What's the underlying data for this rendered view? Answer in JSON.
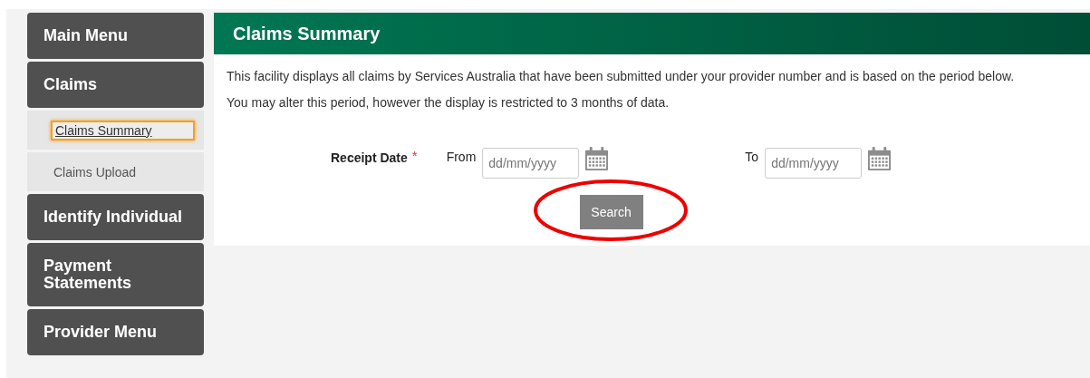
{
  "sidebar": {
    "items": [
      {
        "kind": "section",
        "label": "Main Menu"
      },
      {
        "kind": "section",
        "label": "Claims"
      },
      {
        "kind": "sub",
        "label": "Claims Summary",
        "selected": true
      },
      {
        "kind": "sub",
        "label": "Claims Upload",
        "selected": false
      },
      {
        "kind": "section",
        "label": "Identify Individual"
      },
      {
        "kind": "section",
        "label": "Payment Statements"
      },
      {
        "kind": "section",
        "label": "Provider Menu"
      }
    ]
  },
  "panel": {
    "title": "Claims Summary",
    "paragraphs": [
      "This facility displays all claims by Services Australia that have been submitted under your provider number and is based on the period below.",
      "You may alter this period, however the display is restricted to 3 months of data."
    ],
    "form": {
      "label": "Receipt Date",
      "required_mark": "*",
      "from_label": "From",
      "from_placeholder": "dd/mm/yyyy",
      "to_label": "To",
      "to_placeholder": "dd/mm/yyyy"
    },
    "search_button": {
      "label": "Search",
      "circled": true
    }
  }
}
